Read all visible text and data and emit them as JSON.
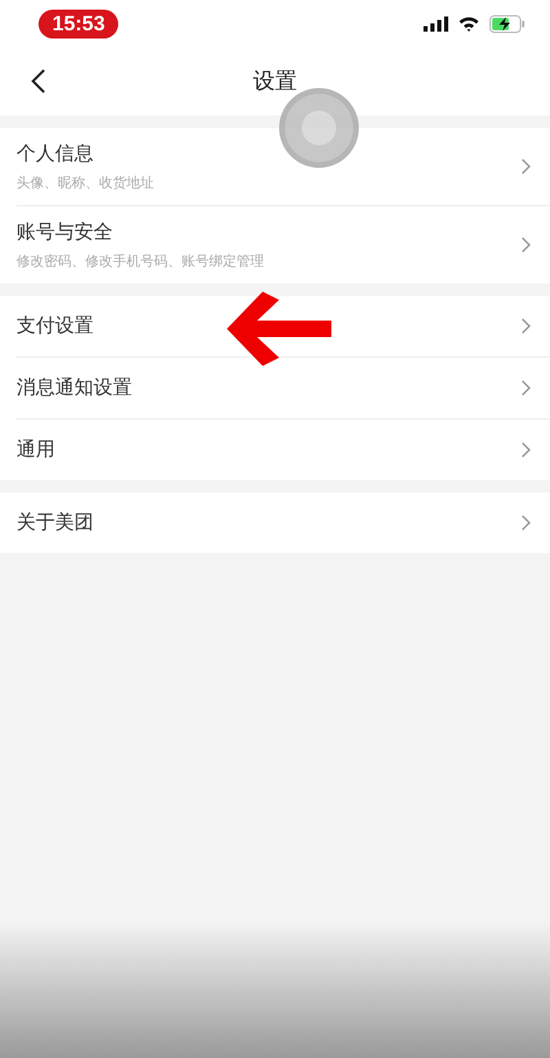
{
  "status_bar": {
    "time": "15:53"
  },
  "nav": {
    "title": "设置"
  },
  "groups": [
    {
      "items": [
        {
          "title": "个人信息",
          "subtitle": "头像、昵称、收货地址"
        },
        {
          "title": "账号与安全",
          "subtitle": "修改密码、修改手机号码、账号绑定管理"
        }
      ]
    },
    {
      "items": [
        {
          "title": "支付设置"
        },
        {
          "title": "消息通知设置"
        },
        {
          "title": "通用"
        }
      ]
    },
    {
      "items": [
        {
          "title": "关于美团"
        }
      ]
    }
  ]
}
